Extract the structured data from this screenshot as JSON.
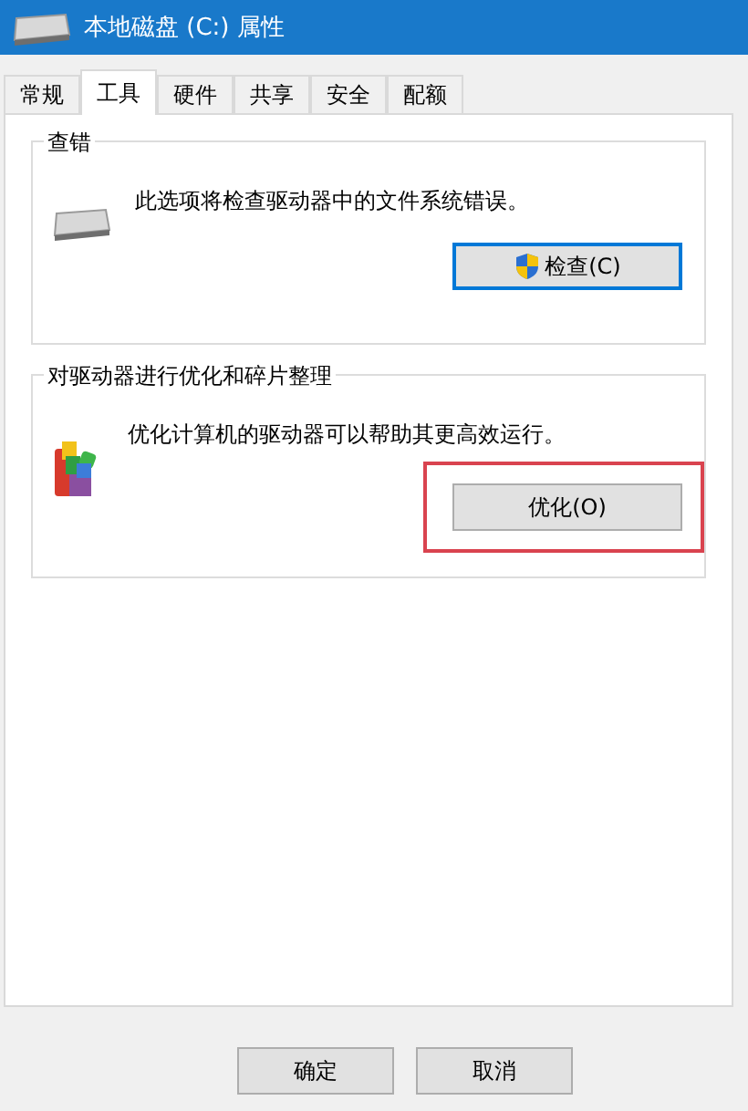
{
  "window": {
    "title": "本地磁盘 (C:) 属性"
  },
  "tabs": [
    {
      "label": "常规",
      "selected": false
    },
    {
      "label": "工具",
      "selected": true
    },
    {
      "label": "硬件",
      "selected": false
    },
    {
      "label": "共享",
      "selected": false
    },
    {
      "label": "安全",
      "selected": false
    },
    {
      "label": "配额",
      "selected": false
    }
  ],
  "groups": [
    {
      "kind": "check",
      "title": "查错",
      "description": "此选项将检查驱动器中的文件系统错误。",
      "button": {
        "label": "检查(C)",
        "shield": true,
        "focused": true,
        "highlighted": false
      }
    },
    {
      "kind": "optimize",
      "title": "对驱动器进行优化和碎片整理",
      "description": "优化计算机的驱动器可以帮助其更高效运行。",
      "button": {
        "label": "优化(O)",
        "shield": false,
        "focused": false,
        "highlighted": true
      }
    }
  ],
  "buttons": [
    "确定",
    "取消"
  ]
}
